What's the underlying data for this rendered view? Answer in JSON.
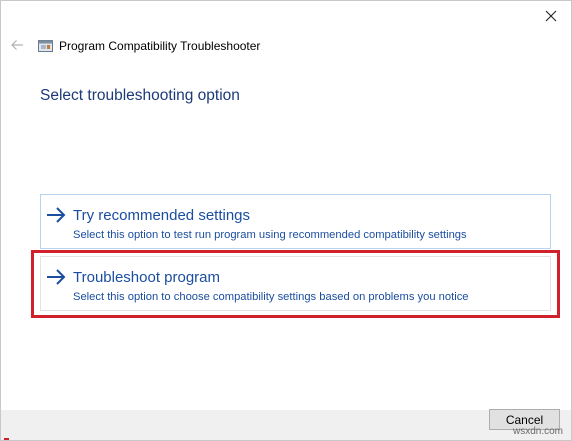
{
  "window": {
    "title": "Program Compatibility Troubleshooter",
    "close_icon": "close-icon",
    "back_icon": "back-arrow-icon"
  },
  "main": {
    "heading": "Select troubleshooting option",
    "options": [
      {
        "title": "Try recommended settings",
        "description": "Select this option to test run program using recommended compatibility settings",
        "icon": "arrow-right-icon"
      },
      {
        "title": "Troubleshoot program",
        "description": "Select this option to choose compatibility settings based on problems you notice",
        "icon": "arrow-right-icon",
        "highlighted": true
      }
    ]
  },
  "footer": {
    "cancel_label": "Cancel"
  },
  "watermark": {
    "text": "wsxdn.com"
  },
  "colors": {
    "accent": "#1b4ea0",
    "heading": "#1c3a78",
    "highlight": "#d0202c",
    "option_border_hover": "#b6d3ef"
  }
}
